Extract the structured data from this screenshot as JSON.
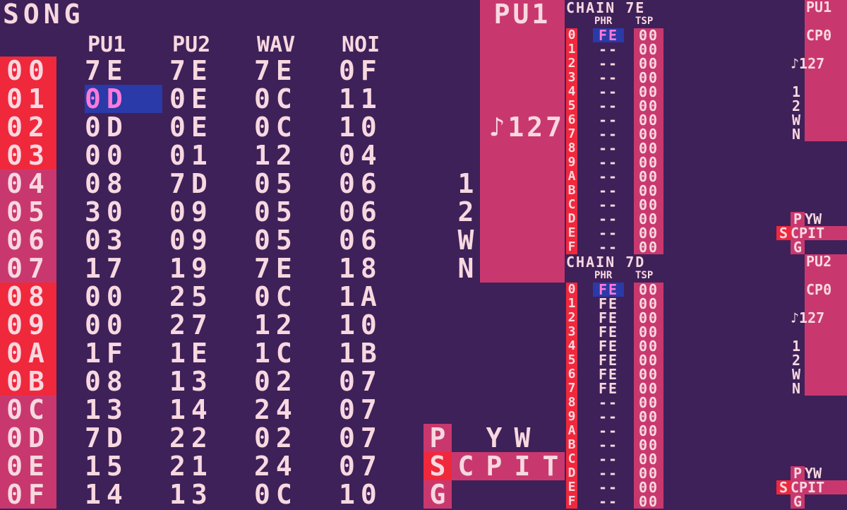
{
  "song": {
    "title": "SONG",
    "columns": [
      "PU1",
      "PU2",
      "WAV",
      "NOI"
    ],
    "row_labels": [
      "00",
      "01",
      "02",
      "03",
      "04",
      "05",
      "06",
      "07",
      "08",
      "09",
      "0A",
      "0B",
      "0C",
      "0D",
      "0E",
      "0F"
    ],
    "rows": [
      [
        "7E",
        "7E",
        "7E",
        "0F"
      ],
      [
        "0D",
        "0E",
        "0C",
        "11"
      ],
      [
        "0D",
        "0E",
        "0C",
        "10"
      ],
      [
        "00",
        "01",
        "12",
        "04"
      ],
      [
        "08",
        "7D",
        "05",
        "06"
      ],
      [
        "30",
        "09",
        "05",
        "06"
      ],
      [
        "03",
        "09",
        "05",
        "06"
      ],
      [
        "17",
        "19",
        "7E",
        "18"
      ],
      [
        "00",
        "25",
        "0C",
        "1A"
      ],
      [
        "00",
        "27",
        "12",
        "10"
      ],
      [
        "1F",
        "1E",
        "1C",
        "1B"
      ],
      [
        "08",
        "13",
        "02",
        "07"
      ],
      [
        "13",
        "14",
        "24",
        "07"
      ],
      [
        "7D",
        "22",
        "02",
        "07"
      ],
      [
        "15",
        "21",
        "24",
        "07"
      ],
      [
        "14",
        "13",
        "0C",
        "10"
      ]
    ],
    "red_rows": [
      0,
      1,
      2,
      3,
      8,
      9,
      10,
      11
    ],
    "selected": {
      "row": 1,
      "col": 0
    }
  },
  "channel": {
    "name": "PU1",
    "volume": "♪127",
    "tracks": [
      "1",
      "2",
      "W",
      "N"
    ]
  },
  "screen_map": {
    "row1": [
      "P",
      "",
      "Y",
      "W",
      "",
      ""
    ],
    "row2": [
      "S",
      "C",
      "P",
      "I",
      "T",
      ""
    ],
    "row3": [
      "G"
    ],
    "active": "S"
  },
  "chains": [
    {
      "title": "CHAIN 7E",
      "headers": [
        "PHR",
        "TSP"
      ],
      "index": [
        "0",
        "1",
        "2",
        "3",
        "4",
        "5",
        "6",
        "7",
        "8",
        "9",
        "A",
        "B",
        "C",
        "D",
        "E",
        "F"
      ],
      "phr": [
        "FE",
        "--",
        "--",
        "--",
        "--",
        "--",
        "--",
        "--",
        "--",
        "--",
        "--",
        "--",
        "--",
        "--",
        "--",
        "--"
      ],
      "tsp": [
        "00",
        "00",
        "00",
        "00",
        "00",
        "00",
        "00",
        "00",
        "00",
        "00",
        "00",
        "00",
        "00",
        "00",
        "00",
        "00"
      ]
    },
    {
      "title": "CHAIN 7D",
      "headers": [
        "PHR",
        "TSP"
      ],
      "index": [
        "0",
        "1",
        "2",
        "3",
        "4",
        "5",
        "6",
        "7",
        "8",
        "9",
        "A",
        "B",
        "C",
        "D",
        "E",
        "F"
      ],
      "phr": [
        "FE",
        "FE",
        "FE",
        "FE",
        "FE",
        "FE",
        "FE",
        "FE",
        "--",
        "--",
        "--",
        "--",
        "--",
        "--",
        "--",
        "--"
      ],
      "tsp": [
        "00",
        "00",
        "00",
        "00",
        "00",
        "00",
        "00",
        "00",
        "00",
        "00",
        "00",
        "00",
        "00",
        "00",
        "00",
        "00"
      ]
    }
  ],
  "mini_panels": [
    {
      "name": "PU1",
      "cp": "CP0",
      "volume": "♪127",
      "tracks": [
        "1",
        "2",
        "W",
        "N"
      ]
    },
    {
      "name": "PU2",
      "cp": "CP0",
      "volume": "♪127",
      "tracks": [
        "1",
        "2",
        "W",
        "N"
      ]
    }
  ],
  "mini_maps": [
    {
      "row1": "PYW",
      "row2": "SCPIT",
      "row3": "G",
      "active": "S"
    },
    {
      "row1": "PYW",
      "row2": "SCPIT",
      "row3": "G",
      "active": "S"
    }
  ],
  "colors": {
    "background": "#3e2158",
    "pink": "#c8386e",
    "red": "#f0283c",
    "text": "#f8d8e0",
    "selection_bg": "#2a3aa8",
    "selection_fg": "#ff7ad8"
  }
}
